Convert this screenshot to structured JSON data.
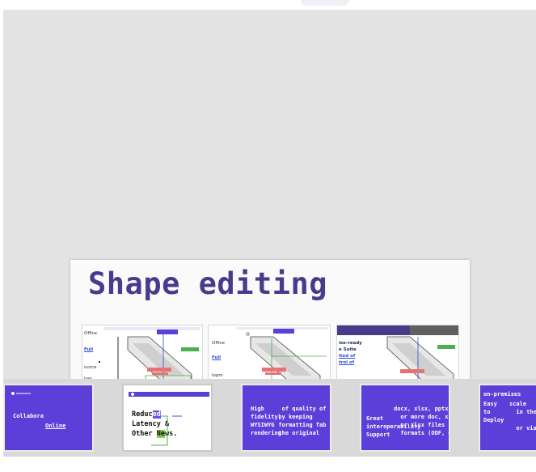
{
  "slide": {
    "title": "Shape editing"
  },
  "screenshots": [
    {
      "lines": [
        "Office",
        "Full",
        "ource",
        "pas"
      ]
    },
    {
      "lines": [
        "Office",
        "Full",
        "lopm"
      ]
    },
    {
      "lines": [
        "ise-ready",
        "e Suite",
        "ited of",
        "trol of"
      ]
    }
  ],
  "thumbnails": [
    {
      "title": "Collabora",
      "subtitle": "Online"
    },
    {
      "line1a": "Reduc",
      "line1b": "ed",
      "line2": "Latency &",
      "line3a": "Other ",
      "line3b": "Ne",
      "line3c": "ws."
    },
    {
      "text": "High\nfidelity,\nWYSIWYG\nrendering"
    },
    {
      "text": "Great\ninteroperability\nSupport"
    },
    {
      "text": "Easy\nto\nDeploy"
    }
  ]
}
